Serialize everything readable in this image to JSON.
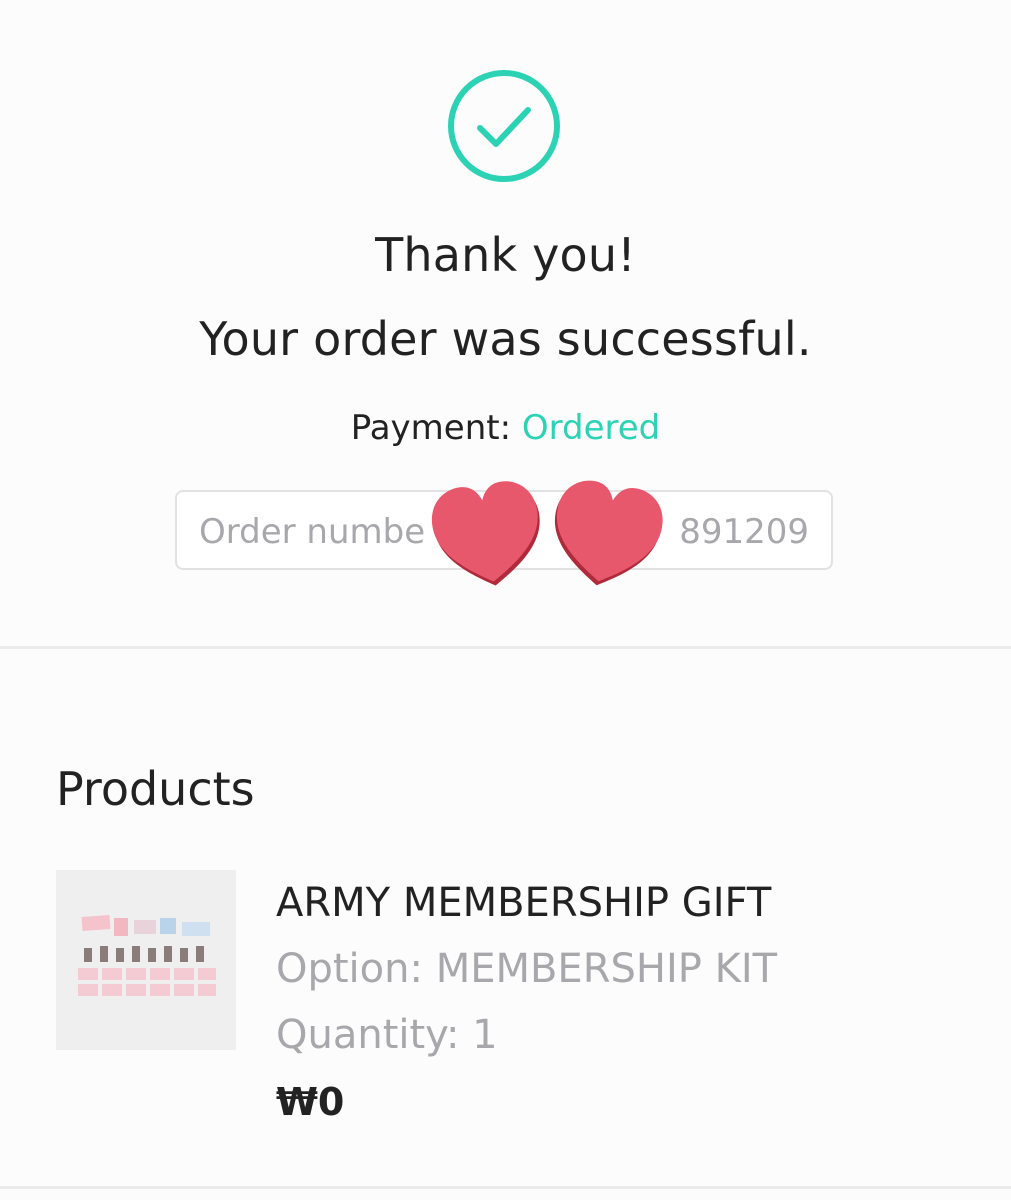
{
  "confirmation": {
    "check_icon": "check-circle-icon",
    "accent_color": "#2bd3b4",
    "thank_you": "Thank you!",
    "message": "Your order was successful.",
    "payment_label": "Payment: ",
    "payment_status": "Ordered",
    "order_number_label": "Order numbe",
    "order_number_value": "891209",
    "sticker_icon": "heart-sticker-icon"
  },
  "products": {
    "title": "Products",
    "items": [
      {
        "name": "ARMY MEMBERSHIP GIFT",
        "option": "Option: MEMBERSHIP KIT",
        "quantity": "Quantity: 1",
        "price": "₩0",
        "thumbnail_icon": "product-thumbnail-image"
      }
    ]
  }
}
